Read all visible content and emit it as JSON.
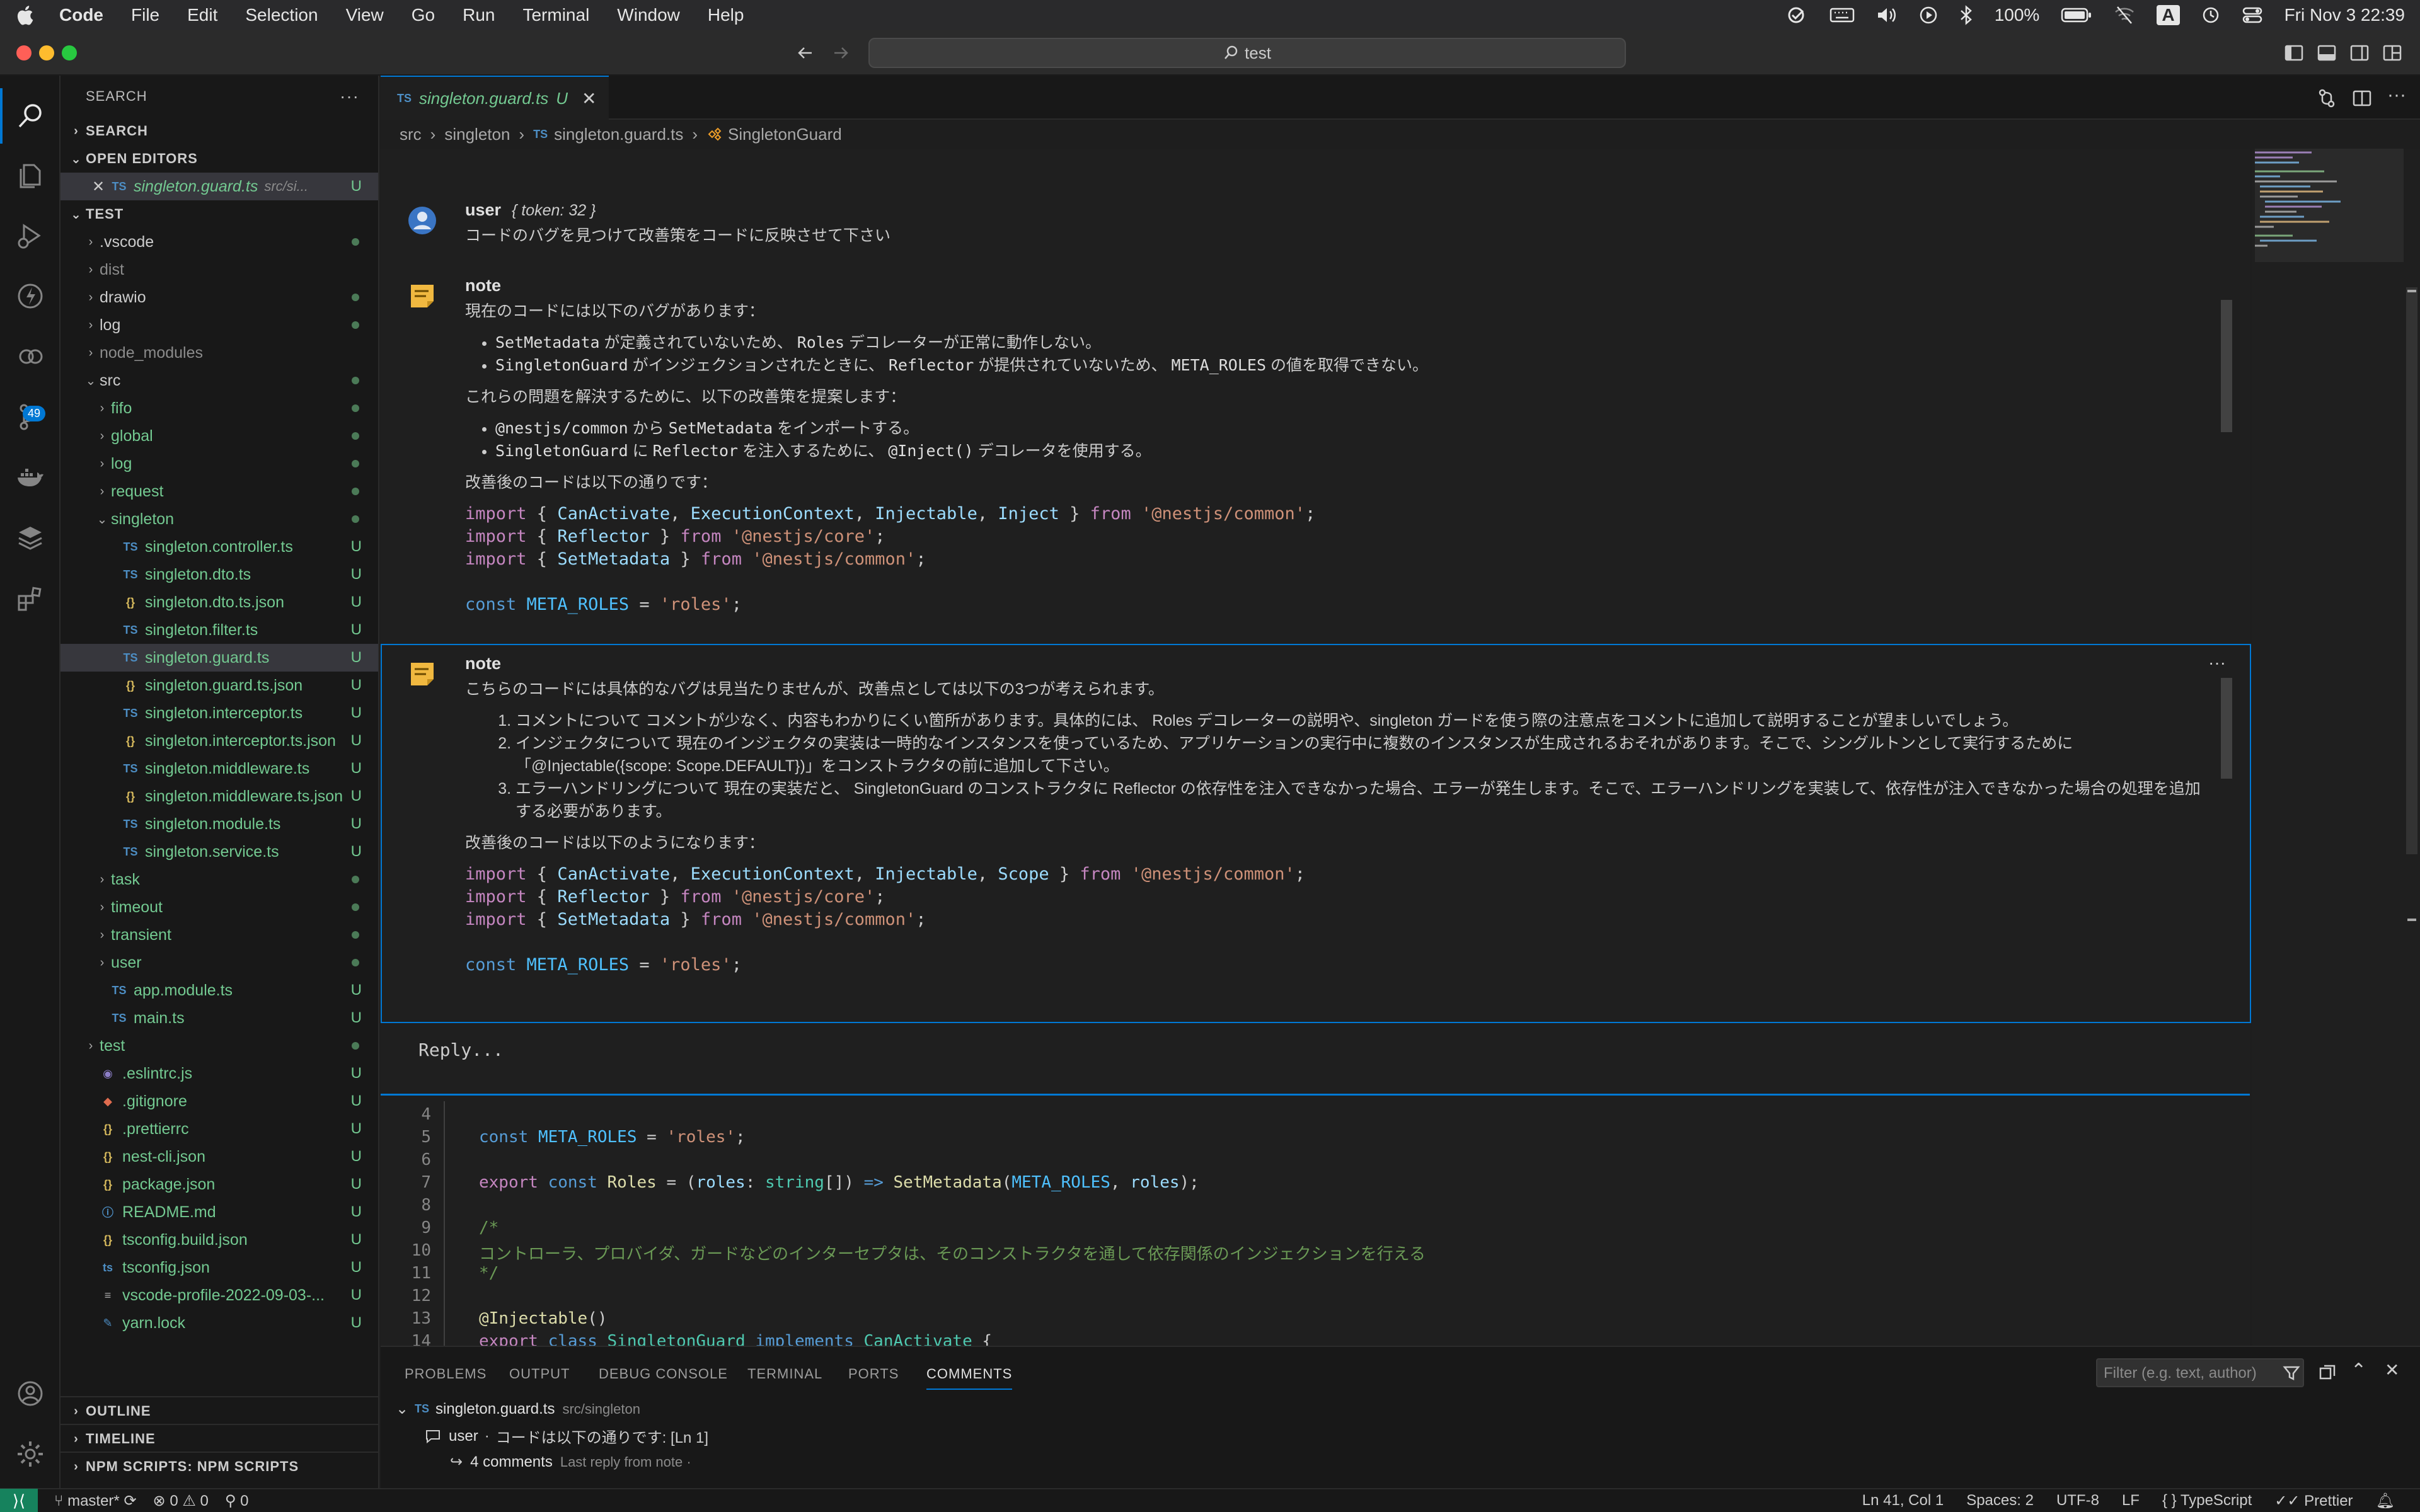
{
  "menubar": {
    "app_name": "Code",
    "menus": [
      "File",
      "Edit",
      "Selection",
      "View",
      "Go",
      "Run",
      "Terminal",
      "Window",
      "Help"
    ],
    "battery": "100%",
    "input_source": "A",
    "clock": "Fri Nov 3  22:39"
  },
  "titlebar": {
    "search_text": "test"
  },
  "activity": {
    "source_control_badge": "49"
  },
  "sidebar": {
    "title": "SEARCH",
    "search_section": "SEARCH",
    "open_editors_section": "OPEN EDITORS",
    "open_editor": {
      "name": "singleton.guard.ts",
      "path": "src/si...",
      "status": "U"
    },
    "test_section": "TEST",
    "tree": [
      {
        "label": ".vscode",
        "type": "folder",
        "depth": 0,
        "state": "collapsed",
        "decor": "dot",
        "color": "normal"
      },
      {
        "label": "dist",
        "type": "folder",
        "depth": 0,
        "state": "collapsed",
        "decor": "",
        "color": "grey"
      },
      {
        "label": "drawio",
        "type": "folder",
        "depth": 0,
        "state": "collapsed",
        "decor": "dot",
        "color": "normal"
      },
      {
        "label": "log",
        "type": "folder",
        "depth": 0,
        "state": "collapsed",
        "decor": "dot",
        "color": "normal"
      },
      {
        "label": "node_modules",
        "type": "folder",
        "depth": 0,
        "state": "collapsed",
        "decor": "",
        "color": "grey"
      },
      {
        "label": "src",
        "type": "folder",
        "depth": 0,
        "state": "expanded",
        "decor": "dot",
        "color": "normal"
      },
      {
        "label": "fifo",
        "type": "folder",
        "depth": 1,
        "state": "collapsed",
        "decor": "dot",
        "color": "green"
      },
      {
        "label": "global",
        "type": "folder",
        "depth": 1,
        "state": "collapsed",
        "decor": "dot",
        "color": "green"
      },
      {
        "label": "log",
        "type": "folder",
        "depth": 1,
        "state": "collapsed",
        "decor": "dot",
        "color": "green"
      },
      {
        "label": "request",
        "type": "folder",
        "depth": 1,
        "state": "collapsed",
        "decor": "dot",
        "color": "green"
      },
      {
        "label": "singleton",
        "type": "folder",
        "depth": 1,
        "state": "expanded",
        "decor": "dot",
        "color": "green"
      },
      {
        "label": "singleton.controller.ts",
        "type": "ts",
        "depth": 2,
        "decor": "U",
        "color": "green"
      },
      {
        "label": "singleton.dto.ts",
        "type": "ts",
        "depth": 2,
        "decor": "U",
        "color": "green"
      },
      {
        "label": "singleton.dto.ts.json",
        "type": "json",
        "depth": 2,
        "decor": "U",
        "color": "green"
      },
      {
        "label": "singleton.filter.ts",
        "type": "ts",
        "depth": 2,
        "decor": "U",
        "color": "green"
      },
      {
        "label": "singleton.guard.ts",
        "type": "ts",
        "depth": 2,
        "decor": "U",
        "color": "green",
        "selected": true
      },
      {
        "label": "singleton.guard.ts.json",
        "type": "json",
        "depth": 2,
        "decor": "U",
        "color": "green"
      },
      {
        "label": "singleton.interceptor.ts",
        "type": "ts",
        "depth": 2,
        "decor": "U",
        "color": "green"
      },
      {
        "label": "singleton.interceptor.ts.json",
        "type": "json",
        "depth": 2,
        "decor": "U",
        "color": "green"
      },
      {
        "label": "singleton.middleware.ts",
        "type": "ts",
        "depth": 2,
        "decor": "U",
        "color": "green"
      },
      {
        "label": "singleton.middleware.ts.json",
        "type": "json",
        "depth": 2,
        "decor": "U",
        "color": "green"
      },
      {
        "label": "singleton.module.ts",
        "type": "ts",
        "depth": 2,
        "decor": "U",
        "color": "green"
      },
      {
        "label": "singleton.service.ts",
        "type": "ts",
        "depth": 2,
        "decor": "U",
        "color": "green"
      },
      {
        "label": "task",
        "type": "folder",
        "depth": 1,
        "state": "collapsed",
        "decor": "dot",
        "color": "green"
      },
      {
        "label": "timeout",
        "type": "folder",
        "depth": 1,
        "state": "collapsed",
        "decor": "dot",
        "color": "green"
      },
      {
        "label": "transient",
        "type": "folder",
        "depth": 1,
        "state": "collapsed",
        "decor": "dot",
        "color": "green"
      },
      {
        "label": "user",
        "type": "folder",
        "depth": 1,
        "state": "collapsed",
        "decor": "dot",
        "color": "green"
      },
      {
        "label": "app.module.ts",
        "type": "ts",
        "depth": 1,
        "decor": "U",
        "color": "green"
      },
      {
        "label": "main.ts",
        "type": "ts",
        "depth": 1,
        "decor": "U",
        "color": "green"
      },
      {
        "label": "test",
        "type": "folder",
        "depth": 0,
        "state": "collapsed",
        "decor": "dot",
        "color": "green"
      },
      {
        "label": ".eslintrc.js",
        "type": "eslint",
        "depth": 0,
        "decor": "U",
        "color": "green"
      },
      {
        "label": ".gitignore",
        "type": "git",
        "depth": 0,
        "decor": "U",
        "color": "green"
      },
      {
        "label": ".prettierrc",
        "type": "json",
        "depth": 0,
        "decor": "U",
        "color": "green"
      },
      {
        "label": "nest-cli.json",
        "type": "json",
        "depth": 0,
        "decor": "U",
        "color": "green"
      },
      {
        "label": "package.json",
        "type": "json",
        "depth": 0,
        "decor": "U",
        "color": "green"
      },
      {
        "label": "README.md",
        "type": "info",
        "depth": 0,
        "decor": "U",
        "color": "green"
      },
      {
        "label": "tsconfig.build.json",
        "type": "json",
        "depth": 0,
        "decor": "U",
        "color": "green"
      },
      {
        "label": "tsconfig.json",
        "type": "tsconfig",
        "depth": 0,
        "decor": "U",
        "color": "green"
      },
      {
        "label": "vscode-profile-2022-09-03-...",
        "type": "text",
        "depth": 0,
        "decor": "U",
        "color": "green"
      },
      {
        "label": "yarn.lock",
        "type": "yarn",
        "depth": 0,
        "decor": "U",
        "color": "green"
      }
    ],
    "outline": "OUTLINE",
    "timeline": "TIMELINE",
    "npm_scripts": "NPM SCRIPTS: NPM SCRIPTS"
  },
  "tab": {
    "prefix": "TS",
    "name": "singleton.guard.ts",
    "status": "U"
  },
  "breadcrumb": {
    "src": "src",
    "folder": "singleton",
    "file_prefix": "TS",
    "file": "singleton.guard.ts",
    "symbol": "SingletonGuard"
  },
  "comments": {
    "user": {
      "author": "user",
      "token": "{ token: 32 }",
      "text": "コードのバグを見つけて改善策をコードに反映させて下さい"
    },
    "note1": {
      "author": "note",
      "intro": "現在のコードには以下のバグがあります：",
      "bugs": [
        [
          "SetMetadata",
          " が定義されていないため、 ",
          "Roles",
          " デコレーターが正常に動作しない。"
        ],
        [
          "SingletonGuard",
          " がインジェクションされたときに、 ",
          "Reflector",
          " が提供されていないため、 ",
          "META_ROLES",
          " の値を取得できない。"
        ]
      ],
      "fix_intro": "これらの問題を解決するために、以下の改善策を提案します：",
      "fixes": [
        [
          "@nestjs/common",
          " から ",
          "SetMetadata",
          " をインポートする。"
        ],
        [
          "SingletonGuard",
          " に ",
          "Reflector",
          " を注入するために、 ",
          "@Inject()",
          " デコレータを使用する。"
        ]
      ],
      "code_intro": "改善後のコードは以下の通りです："
    },
    "note2": {
      "author": "note",
      "intro": "こちらのコードには具体的なバグは見当たりませんが、改善点としては以下の3つが考えられます。",
      "items": [
        "コメントについて コメントが少なく、内容もわかりにくい箇所があります。具体的には、 Roles  デコレーターの説明や、singleton ガードを使う際の注意点をコメントに追加して説明することが望ましいでしょう。",
        "インジェクタについて 現在のインジェクタの実装は一時的なインスタンスを使っているため、アプリケーションの実行中に複数のインスタンスが生成されるおそれがあります。そこで、シングルトンとして実行するために「@Injectable({scope: Scope.DEFAULT})」をコンストラクタの前に追加して下さい。",
        "エラーハンドリングについて 現在の実装だと、 SingletonGuard のコンストラクタに Reflector の依存性を注入できなかった場合、エラーが発生します。そこで、エラーハンドリングを実装して、依存性が注入できなかった場合の処理を追加する必要があります。"
      ],
      "code_intro": "改善後のコードは以下のようになります："
    },
    "reply_placeholder": "Reply..."
  },
  "code": {
    "lines": [
      "4",
      "5",
      "6",
      "7",
      "8",
      "9",
      "10",
      "11",
      "12",
      "13",
      "14"
    ],
    "comment_text": "コントローラ、プロバイダ、ガードなどのインターセプタは、そのコンストラクタを通して依存関係のインジェクションを行える"
  },
  "panel": {
    "tabs": [
      "PROBLEMS",
      "OUTPUT",
      "DEBUG CONSOLE",
      "TERMINAL",
      "PORTS",
      "COMMENTS"
    ],
    "filter_placeholder": "Filter (e.g. text, author)",
    "file_prefix": "TS",
    "file": "singleton.guard.ts",
    "file_path": "src/singleton",
    "comment_author": "user",
    "comment_sep": "·",
    "comment_text": "コードは以下の通りです: [Ln 1]",
    "replies": "4 comments",
    "last_reply": "Last reply from note ·"
  },
  "status": {
    "branch": "master*",
    "errors": "0",
    "warnings": "0",
    "ports": "0",
    "position": "Ln 41, Col 1",
    "spaces": "Spaces: 2",
    "encoding": "UTF-8",
    "eol": "LF",
    "language": "TypeScript",
    "formatter": "Prettier"
  }
}
